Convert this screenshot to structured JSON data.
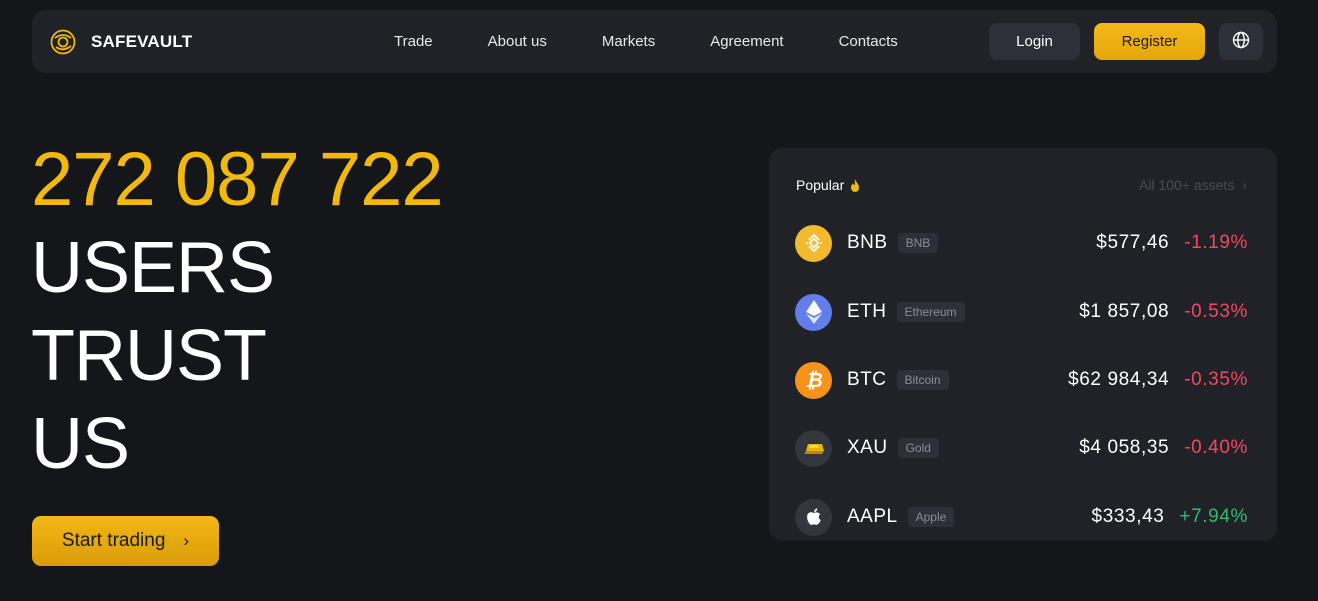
{
  "brand": {
    "name": "SAFEVAULT",
    "logo_icon": "brand-logo-icon",
    "accent": "#f0b90b"
  },
  "nav": {
    "links": [
      "Trade",
      "About us",
      "Markets",
      "Agreement",
      "Contacts"
    ],
    "login_label": "Login",
    "register_label": "Register",
    "language_icon": "globe-icon"
  },
  "hero": {
    "number": "272 087 722",
    "lines": [
      "USERS",
      "TRUST",
      "US"
    ],
    "cta_label": "Start trading",
    "cta_icon": "chevron-right-icon"
  },
  "popular": {
    "title": "Popular",
    "title_icon": "fire-icon",
    "all_assets_label": "All 100+ assets",
    "assets": [
      {
        "ticker": "BNB",
        "name": "BNB",
        "price": "$577,46",
        "change": "-1.19%",
        "direction": "down",
        "icon": "bnb-icon",
        "icon_color": "#f3ba2f"
      },
      {
        "ticker": "ETH",
        "name": "Ethereum",
        "price": "$1 857,08",
        "change": "-0.53%",
        "direction": "down",
        "icon": "eth-icon",
        "icon_color": "#627eea"
      },
      {
        "ticker": "BTC",
        "name": "Bitcoin",
        "price": "$62 984,34",
        "change": "-0.35%",
        "direction": "down",
        "icon": "btc-icon",
        "icon_color": "#f7931a"
      },
      {
        "ticker": "XAU",
        "name": "Gold",
        "price": "$4 058,35",
        "change": "-0.40%",
        "direction": "down",
        "icon": "gold-icon",
        "icon_color": "#33363d"
      },
      {
        "ticker": "AAPL",
        "name": "Apple",
        "price": "$333,43",
        "change": "+7.94%",
        "direction": "up",
        "icon": "apple-icon",
        "icon_color": "#33363d"
      }
    ]
  },
  "colors": {
    "negative": "#f6465d",
    "positive": "#2ebd6f",
    "background": "#151619",
    "panel": "#202228"
  }
}
